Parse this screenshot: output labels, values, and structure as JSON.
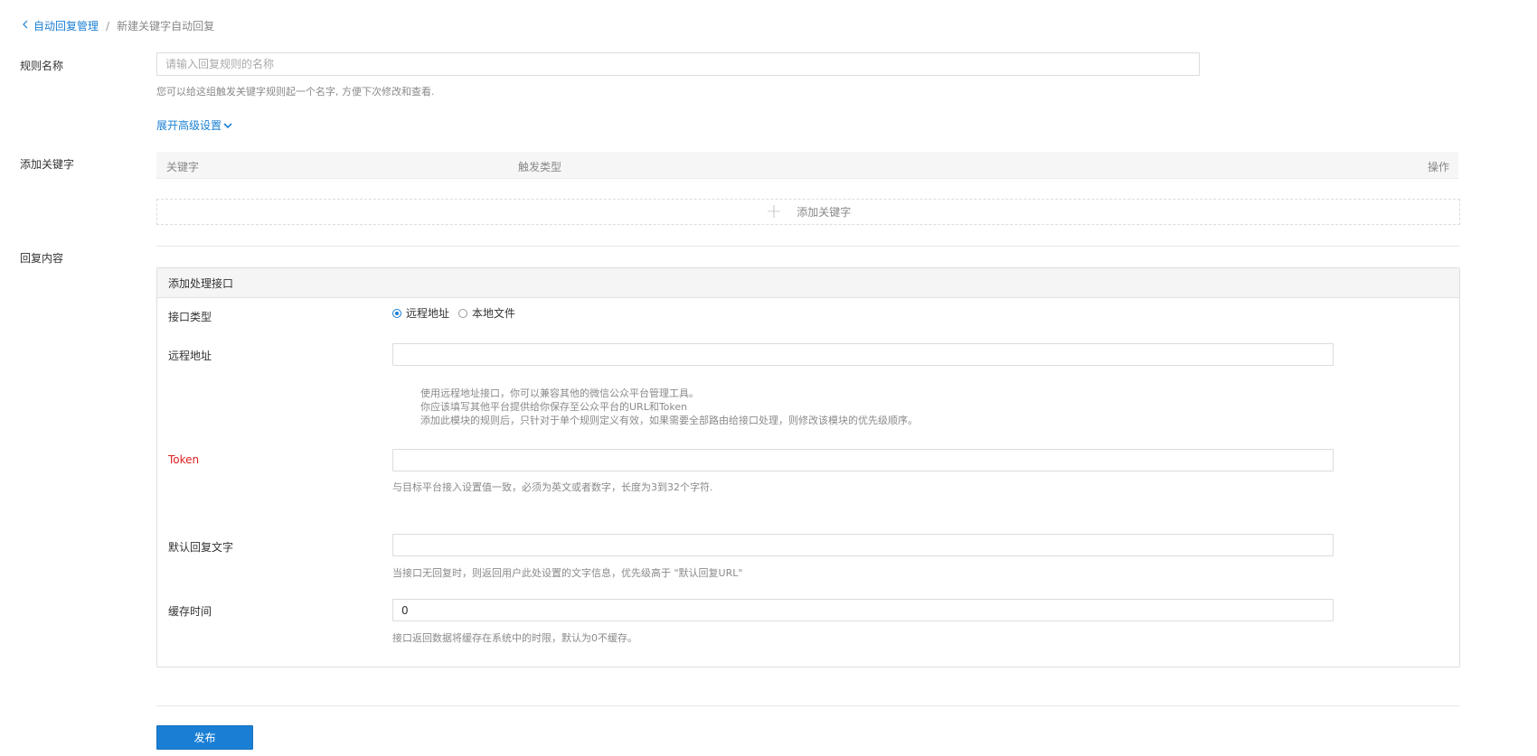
{
  "breadcrumb": {
    "parent": "自动回复管理",
    "separator": "/",
    "current": "新建关键字自动回复"
  },
  "rule_name": {
    "label": "规则名称",
    "placeholder": "请输入回复规则的名称",
    "value": "",
    "help": "您可以给这组触发关键字规则起一个名字, 方便下次修改和查看."
  },
  "advanced": {
    "label": "展开高级设置"
  },
  "keywords": {
    "label": "添加关键字",
    "columns": [
      "关键字",
      "触发类型",
      "操作"
    ],
    "add_label": "添加关键字"
  },
  "reply": {
    "label": "回复内容",
    "panel_title": "添加处理接口",
    "api_type": {
      "label": "接口类型",
      "options": [
        "远程地址",
        "本地文件"
      ],
      "selected": "远程地址"
    },
    "remote_url": {
      "label": "远程地址",
      "value": "",
      "help_lines": [
        "使用远程地址接口，你可以兼容其他的微信公众平台管理工具。",
        "你应该填写其他平台提供给你保存至公众平台的URL和Token",
        "添加此模块的规则后，只针对于单个规则定义有效，如果需要全部路由给接口处理，则修改该模块的优先级顺序。"
      ]
    },
    "token": {
      "label": "Token",
      "value": "",
      "help": "与目标平台接入设置值一致，必须为英文或者数字，长度为3到32个字符."
    },
    "default_text": {
      "label": "默认回复文字",
      "value": "",
      "help": "当接口无回复时，则返回用户此处设置的文字信息，优先级高于 \"默认回复URL\""
    },
    "cache_time": {
      "label": "缓存时间",
      "value": "0",
      "help": "接口返回数据将缓存在系统中的时限，默认为0不缓存。"
    }
  },
  "publish_label": "发布",
  "colors": {
    "accent": "#1a7fd4",
    "token_label": "#e02020",
    "border": "#dcdcdc",
    "help_text": "#8a8a8a"
  }
}
